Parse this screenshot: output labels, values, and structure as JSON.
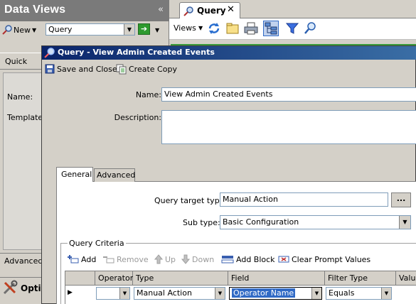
{
  "data_views": {
    "title": "Data Views",
    "collapse_glyph": "«",
    "new_label": "New",
    "query_combo_value": "Query",
    "quick_tab": "Quick",
    "name_label": "Name:",
    "template_label": "Template:",
    "advanced_tab": "Advanced",
    "options_label": "Optic"
  },
  "doc_tab": {
    "label": "Query",
    "close_glyph": "✕"
  },
  "views_toolbar": {
    "views_label": "Views"
  },
  "dialog": {
    "title": "Query  -  View Admin Created Events",
    "save_close_label": "Save and Close",
    "create_copy_label": "Create Copy",
    "name_label": "Name:",
    "name_value": "View Admin Created Events",
    "description_label": "Description:",
    "description_value": "",
    "tabs": {
      "general": "General",
      "advanced": "Advanced"
    },
    "query_target_type_label": "Query target type:",
    "query_target_type_value": "Manual Action",
    "ellipsis_label": "...",
    "sub_type_label": "Sub type:",
    "sub_type_value": "Basic Configuration",
    "query_criteria": {
      "legend": "Query Criteria",
      "toolbar": {
        "add": "Add",
        "remove": "Remove",
        "up": "Up",
        "down": "Down",
        "add_block": "Add Block",
        "clear_prompt": "Clear Prompt Values"
      },
      "columns": [
        "Operator",
        "Type",
        "Field",
        "Filter Type",
        "Value"
      ],
      "row": {
        "indicator": "▶",
        "operator": "",
        "type": "Manual Action",
        "field": "Operator Name",
        "filter_type": "Equals",
        "value": ""
      }
    }
  },
  "colors": {
    "title_bar": "#0a246a",
    "accent_green": "#3a9a3a",
    "selection": "#316ac5"
  }
}
